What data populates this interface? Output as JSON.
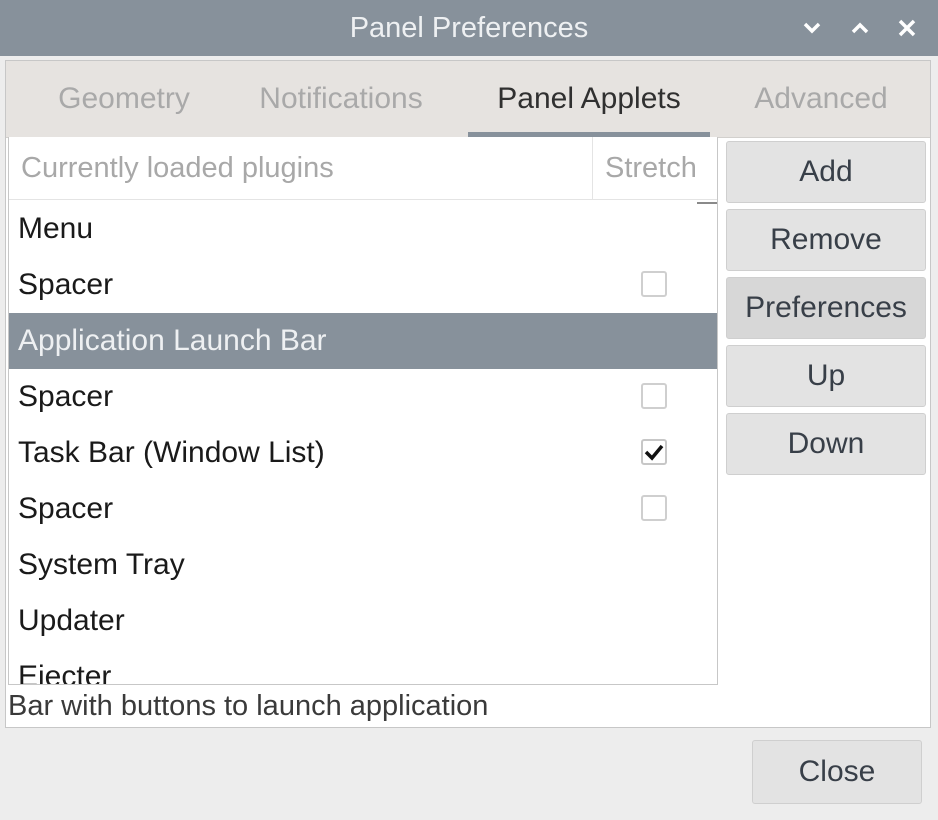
{
  "window": {
    "title": "Panel Preferences",
    "controls": [
      {
        "name": "minimize",
        "icon": "chevron-down-icon"
      },
      {
        "name": "maximize",
        "icon": "chevron-up-icon"
      },
      {
        "name": "close",
        "icon": "close-icon"
      }
    ]
  },
  "tabs": [
    {
      "label": "Geometry",
      "active": false
    },
    {
      "label": "Notifications",
      "active": false
    },
    {
      "label": "Panel Applets",
      "active": true
    },
    {
      "label": "Advanced",
      "active": false
    }
  ],
  "plugins_list": {
    "columns": {
      "plugins": "Currently loaded plugins",
      "stretch": "Stretch"
    },
    "rows": [
      {
        "name": "Menu",
        "stretch": null,
        "selected": false
      },
      {
        "name": "Spacer",
        "stretch": false,
        "selected": false
      },
      {
        "name": "Application Launch Bar",
        "stretch": null,
        "selected": true
      },
      {
        "name": "Spacer",
        "stretch": false,
        "selected": false
      },
      {
        "name": "Task Bar (Window List)",
        "stretch": true,
        "selected": false
      },
      {
        "name": "Spacer",
        "stretch": false,
        "selected": false
      },
      {
        "name": "System Tray",
        "stretch": null,
        "selected": false
      },
      {
        "name": "Updater",
        "stretch": null,
        "selected": false
      },
      {
        "name": "Ejecter",
        "stretch": null,
        "selected": false
      }
    ]
  },
  "side_buttons": {
    "add": "Add",
    "remove": "Remove",
    "preferences": "Preferences",
    "up": "Up",
    "down": "Down"
  },
  "description": "Bar with buttons to launch application",
  "footer": {
    "close": "Close"
  },
  "colors": {
    "titlebar": "#87919b",
    "selection": "#87919b",
    "tab_indicator": "#87919b"
  }
}
